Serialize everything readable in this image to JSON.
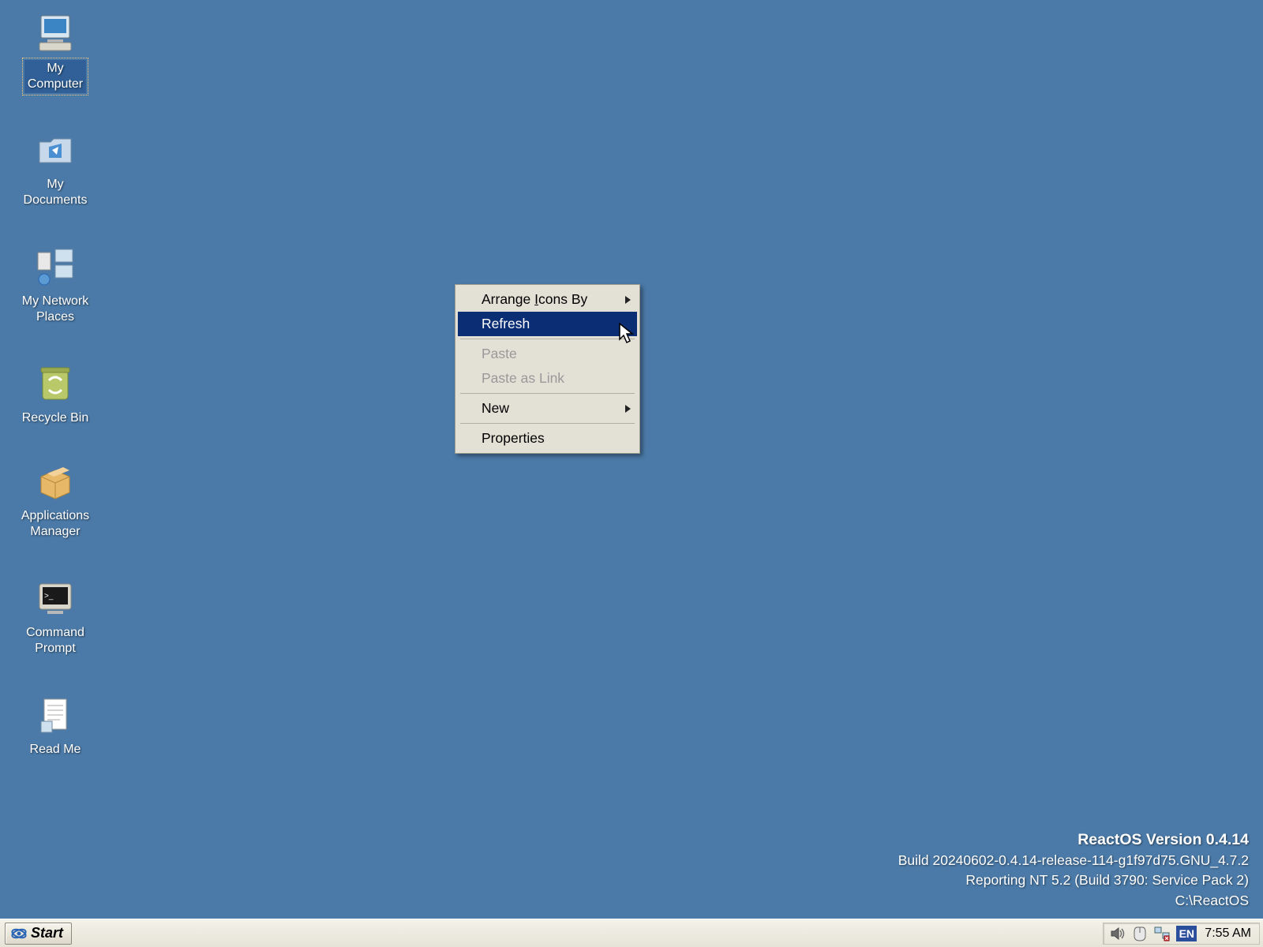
{
  "desktop": {
    "icons": [
      {
        "id": "my-computer",
        "label": "My\nComputer",
        "selected": true,
        "icon": "computer"
      },
      {
        "id": "my-documents",
        "label": "My\nDocuments",
        "selected": false,
        "icon": "folder-docs"
      },
      {
        "id": "my-network-places",
        "label": "My Network\nPlaces",
        "selected": false,
        "icon": "network"
      },
      {
        "id": "recycle-bin",
        "label": "Recycle Bin",
        "selected": false,
        "icon": "recycle"
      },
      {
        "id": "applications-manager",
        "label": "Applications\nManager",
        "selected": false,
        "icon": "box"
      },
      {
        "id": "command-prompt",
        "label": "Command\nPrompt",
        "selected": false,
        "icon": "terminal"
      },
      {
        "id": "read-me",
        "label": "Read Me",
        "selected": false,
        "icon": "textfile"
      }
    ]
  },
  "context_menu": {
    "items": [
      {
        "label_pre": "Arrange ",
        "mnemonic": "I",
        "label_post": "cons By",
        "submenu": true,
        "enabled": true,
        "highlight": false
      },
      {
        "label_pre": "Refresh",
        "mnemonic": "",
        "label_post": "",
        "submenu": false,
        "enabled": true,
        "highlight": true
      },
      {
        "sep": true
      },
      {
        "label_pre": "Paste",
        "mnemonic": "",
        "label_post": "",
        "submenu": false,
        "enabled": false,
        "highlight": false
      },
      {
        "label_pre": "Paste as Link",
        "mnemonic": "",
        "label_post": "",
        "submenu": false,
        "enabled": false,
        "highlight": false
      },
      {
        "sep": true
      },
      {
        "label_pre": "New",
        "mnemonic": "",
        "label_post": "",
        "submenu": true,
        "enabled": true,
        "highlight": false
      },
      {
        "sep": true
      },
      {
        "label_pre": "Properties",
        "mnemonic": "",
        "label_post": "",
        "submenu": false,
        "enabled": true,
        "highlight": false
      }
    ]
  },
  "watermark": {
    "line1": "ReactOS Version 0.4.14",
    "line2": "Build 20240602-0.4.14-release-114-g1f97d75.GNU_4.7.2",
    "line3": "Reporting NT 5.2 (Build 3790: Service Pack 2)",
    "line4": "C:\\ReactOS"
  },
  "taskbar": {
    "start": "Start",
    "lang": "EN",
    "clock": "7:55 AM"
  }
}
